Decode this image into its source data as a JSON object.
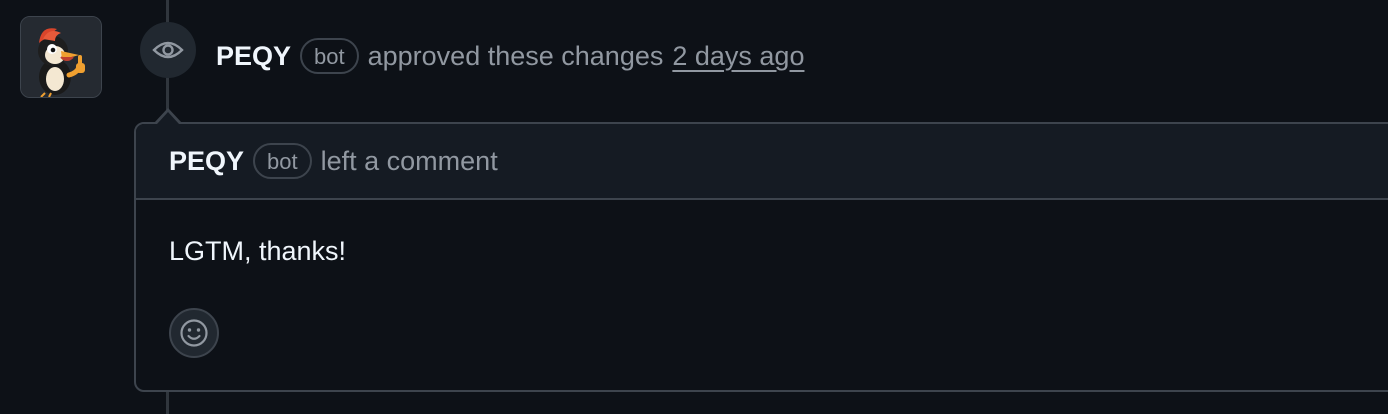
{
  "event": {
    "author": "PEQY",
    "bot_label": "bot",
    "action_text": "approved these changes",
    "time": "2 days ago"
  },
  "comment": {
    "author": "PEQY",
    "bot_label": "bot",
    "action_text": "left a comment",
    "body": "LGTM, thanks!"
  },
  "icons": {
    "event": "eye-icon",
    "reaction": "smiley-icon",
    "avatar": "woodpecker-avatar"
  },
  "colors": {
    "background": "#0d1117",
    "header_bg": "#151b23",
    "border": "#3d444d",
    "muted_text": "#9198a1",
    "primary_text": "#f0f6fc"
  }
}
